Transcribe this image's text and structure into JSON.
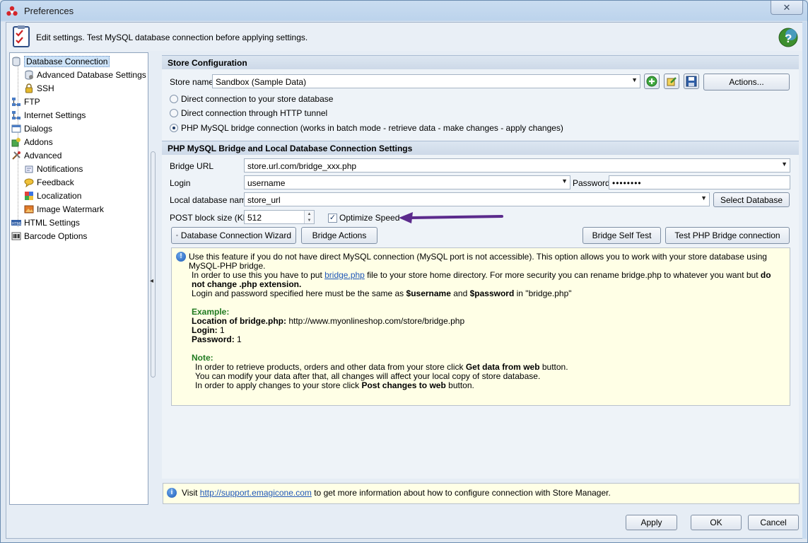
{
  "window": {
    "title": "Preferences",
    "close_label": "✕"
  },
  "header": {
    "text": "Edit settings. Test MySQL database connection before applying settings."
  },
  "tree": {
    "items": [
      {
        "label": "Database Connection"
      },
      {
        "label": "Advanced Database Settings"
      },
      {
        "label": "SSH"
      },
      {
        "label": "FTP"
      },
      {
        "label": "Internet Settings"
      },
      {
        "label": "Dialogs"
      },
      {
        "label": "Addons"
      },
      {
        "label": "Advanced"
      },
      {
        "label": "Notifications"
      },
      {
        "label": "Feedback"
      },
      {
        "label": "Localization"
      },
      {
        "label": "Image Watermark"
      },
      {
        "label": "HTML Settings"
      },
      {
        "label": "Barcode Options"
      }
    ]
  },
  "store_config": {
    "title": "Store Configuration",
    "store_name_label": "Store name",
    "store_name_value": "Sandbox (Sample Data)",
    "actions_label": "Actions...",
    "radios": [
      {
        "label": "Direct connection to your store database",
        "selected": false
      },
      {
        "label": "Direct connection through HTTP tunnel",
        "selected": false
      },
      {
        "label": "PHP MySQL bridge connection (works in batch mode - retrieve data - make changes - apply changes)",
        "selected": true
      }
    ]
  },
  "bridge": {
    "title": "PHP MySQL Bridge and Local Database Connection Settings",
    "url_label": "Bridge URL",
    "url_value": "store.url.com/bridge_xxx.php",
    "login_label": "Login",
    "login_value": "username",
    "password_label": "Password",
    "password_value": "••••••••",
    "localdb_label": "Local database name",
    "localdb_value": "store_url",
    "select_db_label": "Select Database",
    "post_block_label": "POST block size (Kb)",
    "post_block_value": "512",
    "optimize_label": "Optimize Speed",
    "wizard_label": "Database Connection Wizard",
    "bridge_actions_label": "Bridge Actions",
    "self_test_label": "Bridge Self Test",
    "test_conn_label": "Test PHP Bridge connection"
  },
  "info": {
    "line1": "Use this feature if you do not have direct MySQL connection (MySQL port is not accessible). This option allows you to work with your store database using MySQL-PHP bridge.",
    "line2a": "In order to use this you have to put ",
    "line2_link": "bridge.php",
    "line2b": " file to your store home directory. For more security you can rename bridge.php to whatever you want but ",
    "line2_bold": "do not change .php extension.",
    "line3a": "Login and password specified here must be the same as ",
    "line3_b1": "$username",
    "line3_and": " and ",
    "line3_b2": "$password",
    "line3_end": " in \"bridge.php\"",
    "example_title": "Example:",
    "ex_loc_label": "Location of bridge.php:",
    "ex_loc_value": " http://www.myonlineshop.com/store/bridge.php",
    "ex_login_label": "Login:",
    "ex_login_value": " 1",
    "ex_pass_label": "Password:",
    "ex_pass_value": " 1",
    "note_title": "Note:",
    "note1a": "In order to retrieve products, orders and other data from your store click ",
    "note1b": "Get data from web",
    "note1c": " button.",
    "note2": "You can modify your data after that, all changes will affect your local copy of store database.",
    "note3a": "In order to apply changes to your store click ",
    "note3b": "Post changes to web",
    "note3c": " button."
  },
  "bottom_info": {
    "prefix": "Visit ",
    "link": "http://support.emagicone.com",
    "suffix": " to get more information about how to configure connection with Store Manager."
  },
  "footer": {
    "apply": "Apply",
    "ok": "OK",
    "cancel": "Cancel"
  },
  "colors": {
    "arrow": "#5b2a8c",
    "accent": "#1f57b8"
  }
}
